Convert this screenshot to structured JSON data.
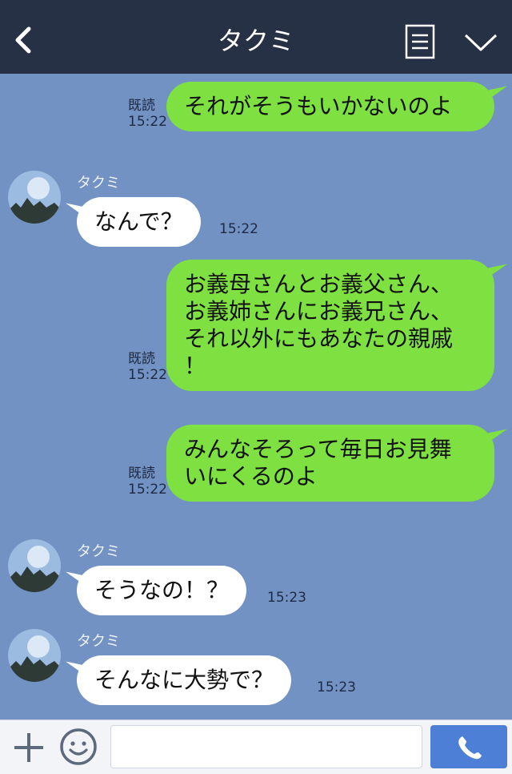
{
  "header": {
    "title": "タクミ"
  },
  "chat": {
    "messages": [
      {
        "type": "out",
        "text": "それがそうもいかないのよ",
        "read": "既読",
        "time": "15:22"
      },
      {
        "type": "in",
        "sender": "タクミ",
        "text": "なんで？",
        "time": "15:22"
      },
      {
        "type": "out",
        "text": "お義母さんとお義父さん、\nお義姉さんにお義兄さん、\nそれ以外にもあなたの親戚\n！",
        "read": "既読",
        "time": "15:22"
      },
      {
        "type": "out",
        "text": "みんなそろって毎日お見舞\nいにくるのよ",
        "read": "既読",
        "time": "15:22"
      },
      {
        "type": "in",
        "sender": "タクミ",
        "text": "そうなの！？",
        "time": "15:23"
      },
      {
        "type": "in",
        "sender": "タクミ",
        "text": "そんなに大勢で？",
        "time": "15:23"
      }
    ]
  },
  "colors": {
    "header_bg": "#263146",
    "chat_bg": "#7192c2",
    "out_bubble": "#7ee041",
    "in_bubble": "#ffffff",
    "send_button": "#4d7fd6"
  },
  "icons": [
    "back-chevron-icon",
    "menu-list-icon",
    "chevron-down-icon",
    "plus-icon",
    "emoji-icon",
    "phone-icon"
  ]
}
